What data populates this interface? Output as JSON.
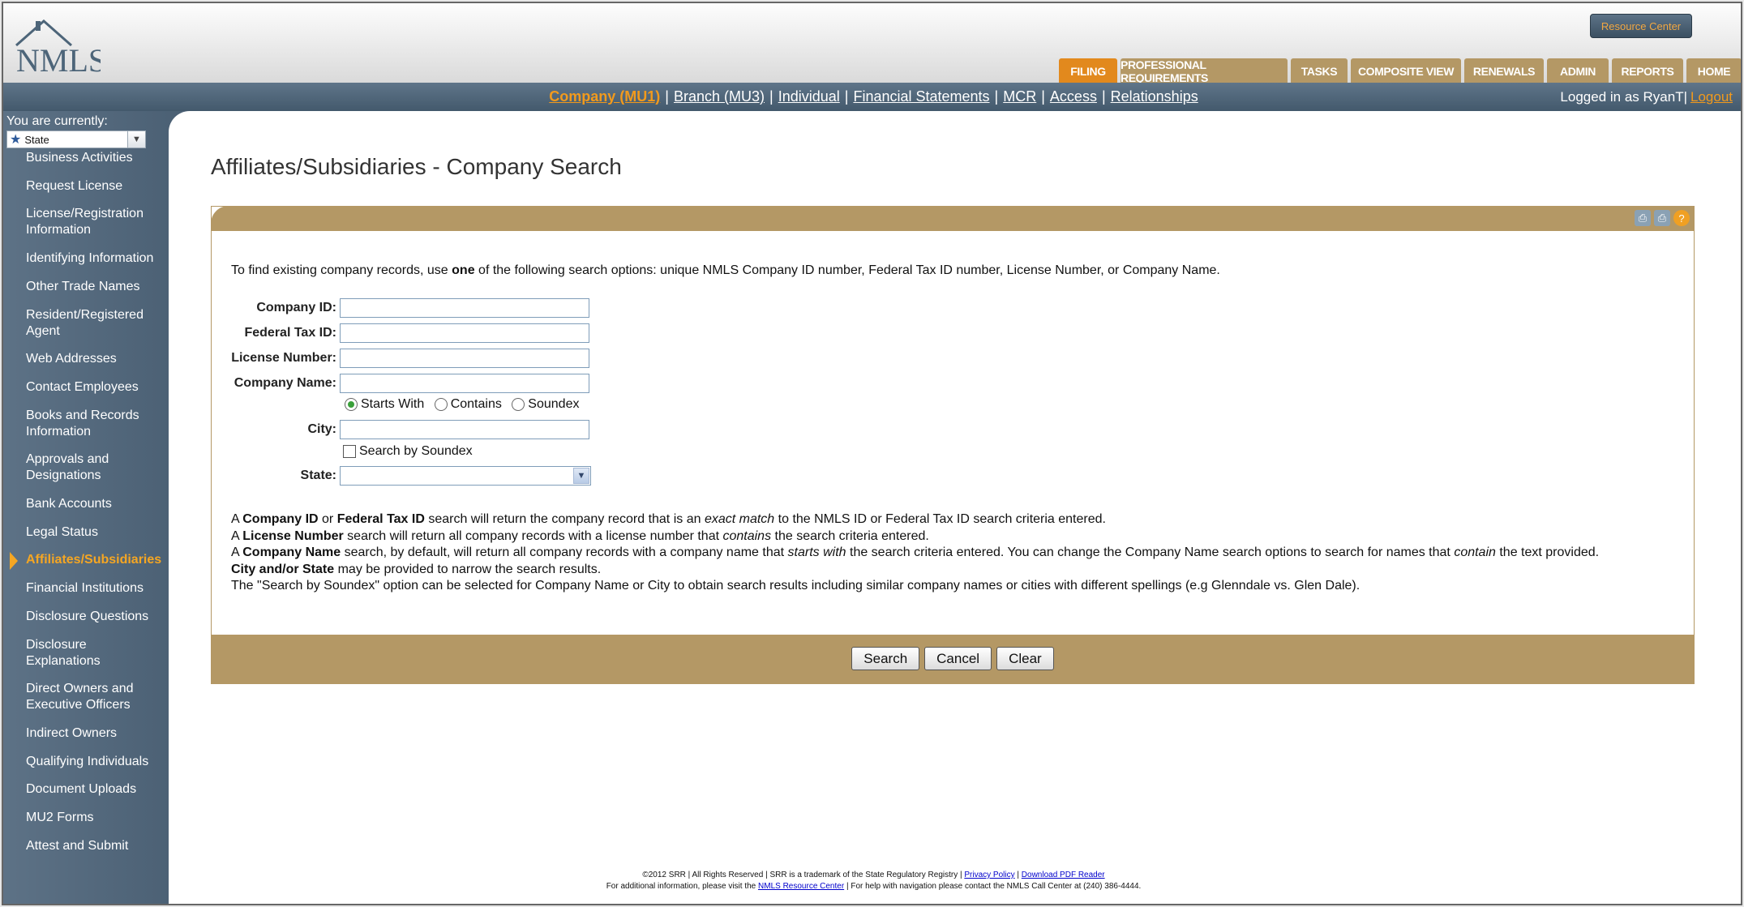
{
  "header": {
    "logo_text": "NMLS",
    "resource_center": "Resource Center",
    "tabs": [
      {
        "label": "FILING",
        "active": true
      },
      {
        "label": "PROFESSIONAL REQUIREMENTS",
        "active": false
      },
      {
        "label": "TASKS",
        "active": false
      },
      {
        "label": "COMPOSITE VIEW",
        "active": false
      },
      {
        "label": "RENEWALS",
        "active": false
      },
      {
        "label": "ADMIN",
        "active": false
      },
      {
        "label": "REPORTS",
        "active": false
      },
      {
        "label": "HOME",
        "active": false
      }
    ]
  },
  "subnav": {
    "links": [
      {
        "label": "Company (MU1)",
        "active": true
      },
      {
        "label": "Branch (MU3)",
        "active": false
      },
      {
        "label": "Individual",
        "active": false
      },
      {
        "label": "Financial Statements",
        "active": false
      },
      {
        "label": "MCR",
        "active": false
      },
      {
        "label": "Access",
        "active": false
      },
      {
        "label": "Relationships",
        "active": false
      }
    ],
    "separator": "|",
    "logged_in": "Logged in as RyanT",
    "logged_in_sep": "|",
    "logout": "Logout"
  },
  "sidebar": {
    "you_are_currently": "You are currently:",
    "state_select": "State",
    "items": [
      {
        "label": "Business Activities",
        "lines": 1
      },
      {
        "label": "Request License",
        "lines": 1
      },
      {
        "label": "License/Registration Information",
        "lines": 2
      },
      {
        "label": "Identifying Information",
        "lines": 1
      },
      {
        "label": "Other Trade Names",
        "lines": 1
      },
      {
        "label": "Resident/Registered Agent",
        "lines": 2
      },
      {
        "label": "Web Addresses",
        "lines": 1
      },
      {
        "label": "Contact Employees",
        "lines": 1
      },
      {
        "label": "Books and Records Information",
        "lines": 2
      },
      {
        "label": "Approvals and Designations",
        "lines": 2
      },
      {
        "label": "Bank Accounts",
        "lines": 1
      },
      {
        "label": "Legal Status",
        "lines": 1
      },
      {
        "label": "Affiliates/Subsidiaries",
        "lines": 1,
        "active": true
      },
      {
        "label": "Financial Institutions",
        "lines": 1
      },
      {
        "label": "Disclosure Questions",
        "lines": 1
      },
      {
        "label": "Disclosure Explanations",
        "lines": 2
      },
      {
        "label": "Direct Owners and Executive Officers",
        "lines": 2
      },
      {
        "label": "Indirect Owners",
        "lines": 1
      },
      {
        "label": "Qualifying Individuals",
        "lines": 1
      },
      {
        "label": "Document Uploads",
        "lines": 1
      },
      {
        "label": "MU2 Forms",
        "lines": 1
      },
      {
        "label": "Attest and Submit",
        "lines": 1
      }
    ]
  },
  "page": {
    "title": "Affiliates/Subsidiaries - Company Search",
    "intro": {
      "before": "To find existing company records, use ",
      "bold": "one",
      "after": " of the following search options: unique NMLS Company ID number, Federal Tax ID number, License Number, or Company Name."
    },
    "form": {
      "company_id_label": "Company ID:",
      "company_id_value": "",
      "federal_tax_id_label": "Federal Tax ID:",
      "federal_tax_id_value": "",
      "license_number_label": "License Number:",
      "license_number_value": "",
      "company_name_label": "Company Name:",
      "company_name_value": "",
      "name_options": [
        "Starts With",
        "Contains",
        "Soundex"
      ],
      "name_option_selected": "Starts With",
      "city_label": "City:",
      "city_value": "",
      "soundex_label": "Search by Soundex",
      "soundex_checked": false,
      "state_label": "State:",
      "state_value": ""
    },
    "help": {
      "l1": [
        "A ",
        "Company ID",
        " or ",
        "Federal Tax ID",
        " search will return the company record that is an ",
        "exact match",
        " to the NMLS ID or Federal Tax ID search criteria entered."
      ],
      "l2": [
        "A ",
        "License Number",
        " search will return all company records with a license number that ",
        "contains",
        " the search criteria entered."
      ],
      "l3": [
        "A ",
        "Company Name",
        " search, by default, will return all company records with a company name that ",
        "starts with",
        " the search criteria entered. You can change the Company Name search options to search for names that ",
        "contain",
        " the text provided."
      ],
      "l4": [
        "City and/or State",
        " may be provided to narrow the search results."
      ],
      "l5": "The \"Search by Soundex\" option can be selected for Company Name or City to obtain search results including similar company names or cities with different spellings (e.g Glenndale vs. Glen Dale)."
    },
    "buttons": {
      "search": "Search",
      "cancel": "Cancel",
      "clear": "Clear"
    }
  },
  "footer": {
    "line1_text": "©2012 SRR | All Rights Reserved | SRR is a trademark of the State Regulatory Registry |",
    "privacy": "Privacy Policy",
    "line1_sep": "|",
    "pdf": "Download PDF Reader",
    "line2_before": "For additional information, please visit the",
    "resource_link": "NMLS Resource Center",
    "line2_after": "| For help with navigation please contact the NMLS Call Center at (240) 386-4444."
  },
  "colors": {
    "tab_gold": "#b49865",
    "tab_active": "#e2891d",
    "nav_blue": "#4c6175",
    "accent_orange": "#f5a623"
  }
}
